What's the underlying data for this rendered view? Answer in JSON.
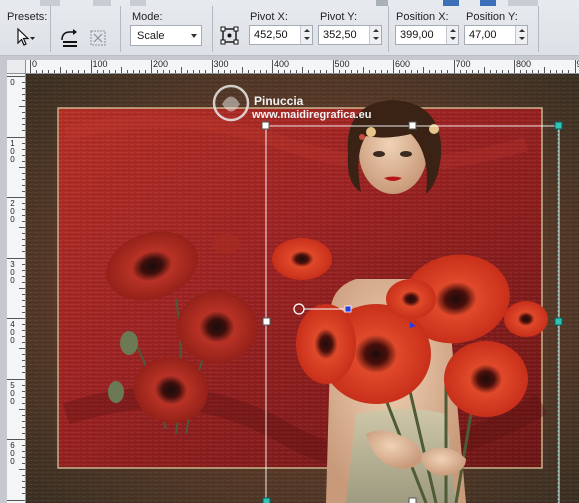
{
  "toolbar": {
    "presets_label": "Presets:",
    "mode_label": "Mode:",
    "mode_value": "Scale",
    "pivot_x_label": "Pivot X:",
    "pivot_x_value": "452,50",
    "pivot_y_label": "Pivot Y:",
    "pivot_y_value": "352,50",
    "position_x_label": "Position X:",
    "position_x_value": "399,00",
    "position_y_label": "Position Y:",
    "position_y_value": "47,00"
  },
  "rulers": {
    "top_labels": [
      "0",
      "100",
      "200",
      "300",
      "400",
      "500",
      "600",
      "700",
      "800",
      "9"
    ],
    "left_labels": [
      "0",
      "100",
      "200",
      "300",
      "400",
      "500",
      "600"
    ]
  },
  "watermark": {
    "name": "Pinuccia",
    "url": "www.maidiregrafica.eu"
  },
  "colors": {
    "toolbar_bg": "#dde1e6",
    "backdrop_red": "#9c2323",
    "poppy_red": "#e23a20",
    "handle_blue": "#2a3be0",
    "guide_white": "#ffffff"
  },
  "icons": [
    "pick-tool-icon",
    "transform-icon",
    "merge-icon",
    "pivot-icon"
  ]
}
